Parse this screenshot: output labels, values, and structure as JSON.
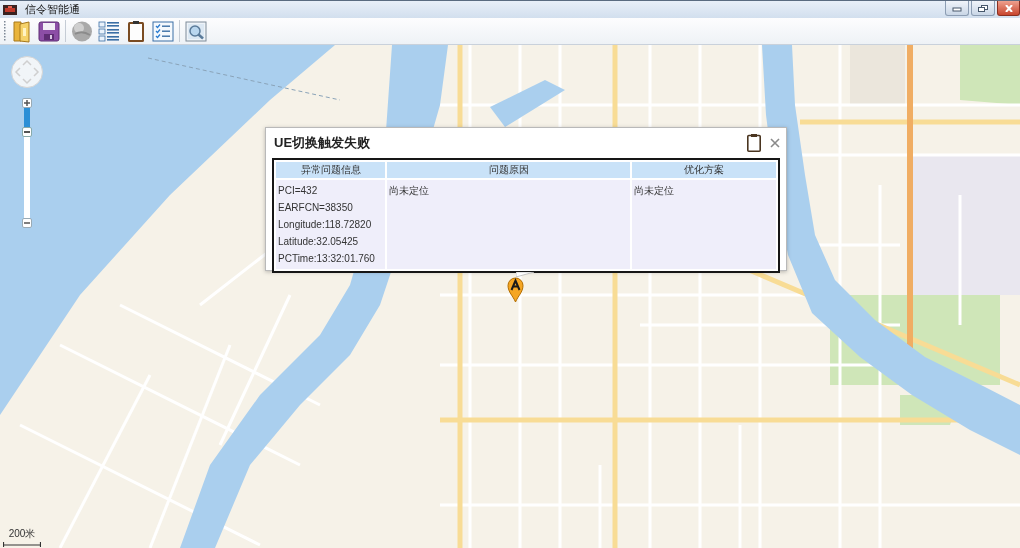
{
  "window": {
    "title": "信令智能通"
  },
  "map": {
    "zoom_slider": {
      "level": 0.22
    },
    "scale": {
      "label": "200米"
    },
    "popup": {
      "title": "UE切换触发失败",
      "table": {
        "columns": [
          "异常问题信息",
          "问题原因",
          "优化方案"
        ],
        "rows": [
          {
            "cells": [
              [
                "PCI=432",
                "EARFCN=38350",
                "Longitude:118.72820",
                "Latitude:32.05425",
                "PCTime:13:32:01.760"
              ],
              [
                "尚未定位"
              ],
              [
                "尚未定位"
              ]
            ]
          }
        ]
      }
    }
  }
}
